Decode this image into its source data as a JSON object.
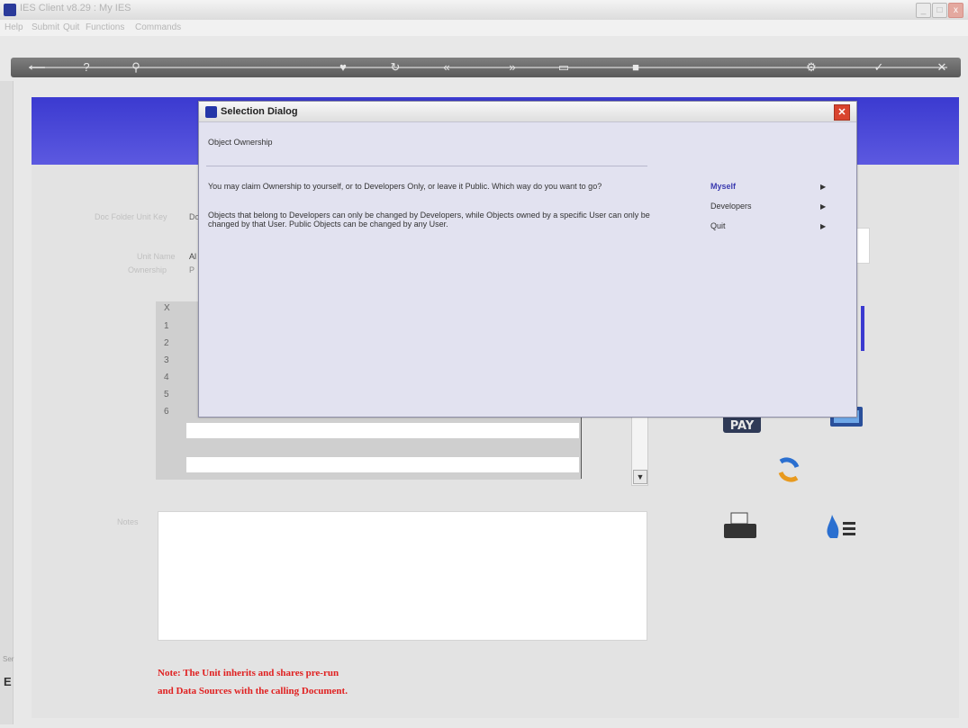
{
  "window": {
    "title": "IES Client v8.29 : My IES",
    "minimize": "_",
    "maximize": "□",
    "close": "x"
  },
  "menubar": {
    "items": [
      "Help",
      "Submit",
      "Quit",
      "Functions",
      "Commands"
    ]
  },
  "toolbar": {
    "icons": [
      "back-icon",
      "help-icon",
      "search-icon",
      "heart-icon",
      "refresh-icon",
      "rewind-icon",
      "forward-icon",
      "page-icon",
      "stop-icon",
      "settings-icon",
      "check-icon",
      "cancel-icon"
    ]
  },
  "form": {
    "labels": {
      "doc_folder": "Doc Folder Unit Key",
      "unit_name": "Unit Name",
      "ownership": "Ownership",
      "notes": "Notes"
    },
    "values": {
      "doc_folder": "Do",
      "unit_name": "Al",
      "ownership": "P"
    },
    "grid": {
      "header": "X",
      "rows": [
        "1",
        "2",
        "3",
        "4",
        "5",
        "6"
      ]
    },
    "notes_text": "",
    "note_line1": "Note: The Unit inherits and shares pre-run",
    "note_line2": "and Data Sources with the calling Document.",
    "side_char": "E",
    "side_label": "Ser"
  },
  "dialog": {
    "title": "Selection Dialog",
    "heading": "Object Ownership",
    "paragraph1": "You may claim Ownership to yourself, or to Developers Only, or leave it Public. Which way do you want to go?",
    "paragraph2": "Objects that belong to Developers can only be changed by Developers, while Objects owned by a specific User can only be changed by that User. Public Objects can be changed by any User.",
    "options": [
      {
        "label": "Myself",
        "selected": true
      },
      {
        "label": "Developers",
        "selected": false
      },
      {
        "label": "Quit",
        "selected": false
      }
    ],
    "option_arrow": "▶"
  },
  "colors": {
    "accent_blue": "#3b3ad0",
    "note_red": "#e02020",
    "dialog_bg": "#e2e2f0",
    "close_red": "#d9442e"
  }
}
